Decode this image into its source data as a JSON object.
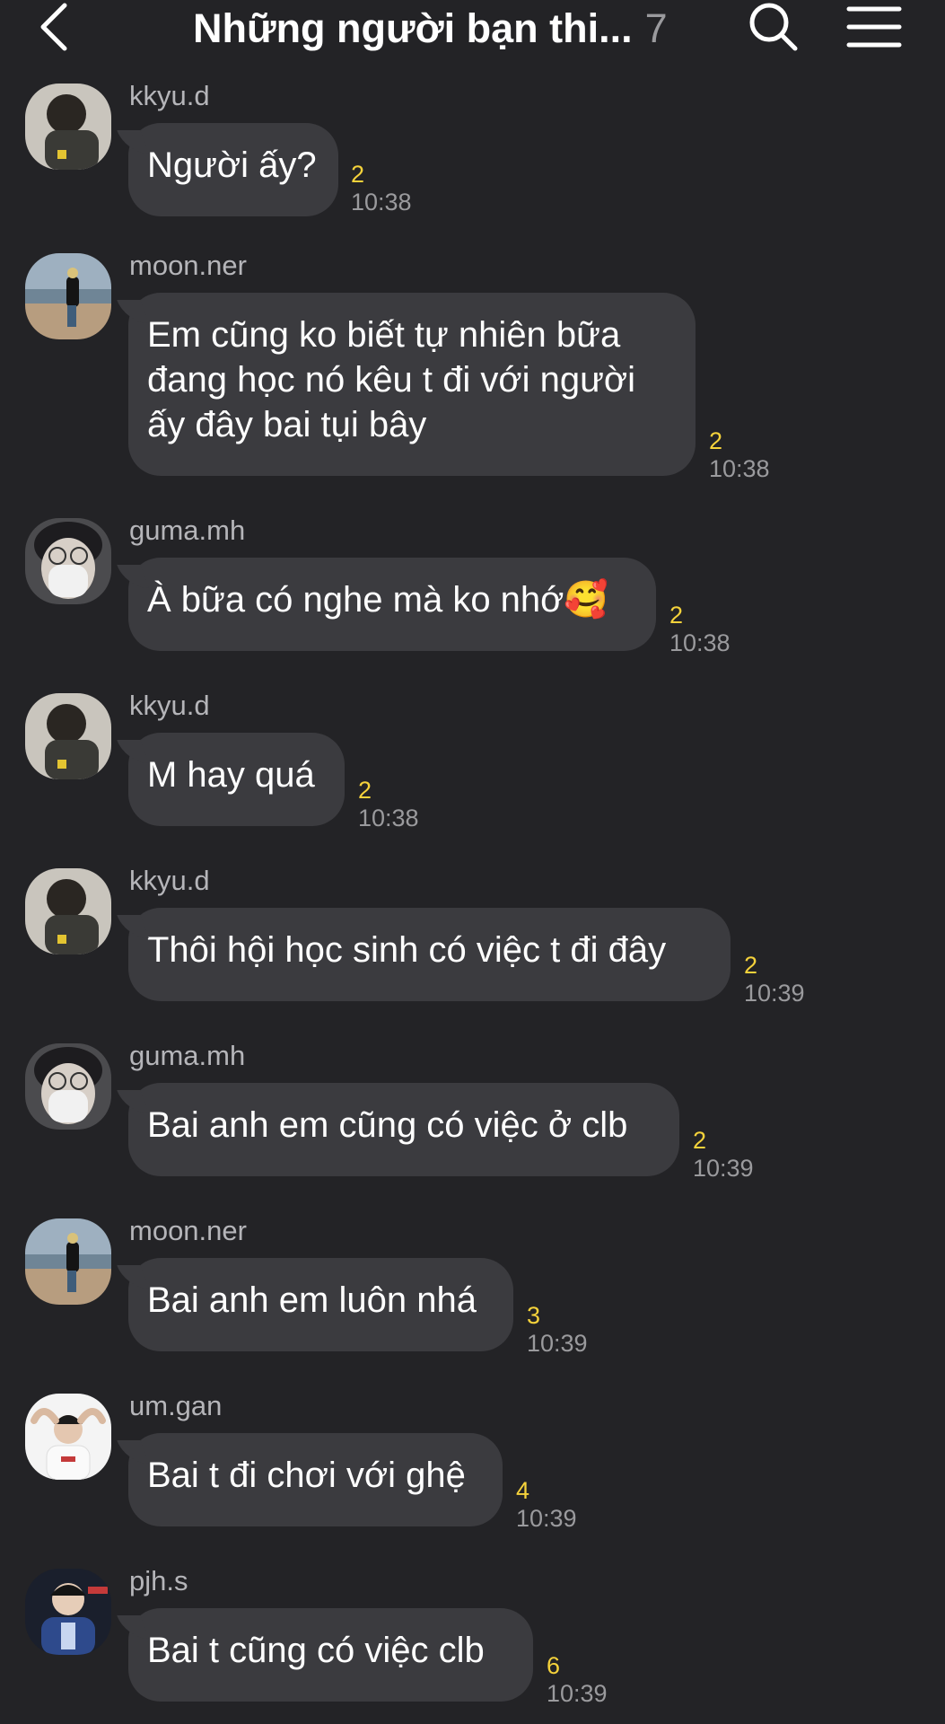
{
  "header": {
    "title": "Những người bạn thi...",
    "member_count": "7"
  },
  "messages": [
    {
      "user": "kkyu.d",
      "text": "Người ấy?",
      "unread": "2",
      "time": "10:38",
      "avatar": "kkyu"
    },
    {
      "user": "moon.ner",
      "text": "Em cũng ko biết tự nhiên bữa\nđang học nó kêu t đi với người\nấy đây bai tụi bây",
      "unread": "2",
      "time": "10:38",
      "avatar": "moon"
    },
    {
      "user": "guma.mh",
      "text": "À bữa có nghe mà ko nhớ🥰",
      "unread": "2",
      "time": "10:38",
      "avatar": "guma"
    },
    {
      "user": "kkyu.d",
      "text": "M hay quá",
      "unread": "2",
      "time": "10:38",
      "avatar": "kkyu"
    },
    {
      "user": "kkyu.d",
      "text": "Thôi hội học sinh có việc t đi đây",
      "unread": "2",
      "time": "10:39",
      "avatar": "kkyu"
    },
    {
      "user": "guma.mh",
      "text": "Bai anh em cũng có việc ở clb",
      "unread": "2",
      "time": "10:39",
      "avatar": "guma"
    },
    {
      "user": "moon.ner",
      "text": "Bai anh em luôn nhá",
      "unread": "3",
      "time": "10:39",
      "avatar": "moon"
    },
    {
      "user": "um.gan",
      "text": "Bai t đi chơi với ghệ",
      "unread": "4",
      "time": "10:39",
      "avatar": "umgan"
    },
    {
      "user": "pjh.s",
      "text": "Bai t cũng có việc clb",
      "unread": "6",
      "time": "10:39",
      "avatar": "pjh"
    }
  ],
  "colors": {
    "background": "#232326",
    "bubble": "#3b3b3f",
    "unread": "#f5d23b",
    "secondary_text": "#9a9a9d"
  },
  "icons": [
    "chevron-left-icon",
    "search-icon",
    "menu-icon"
  ]
}
